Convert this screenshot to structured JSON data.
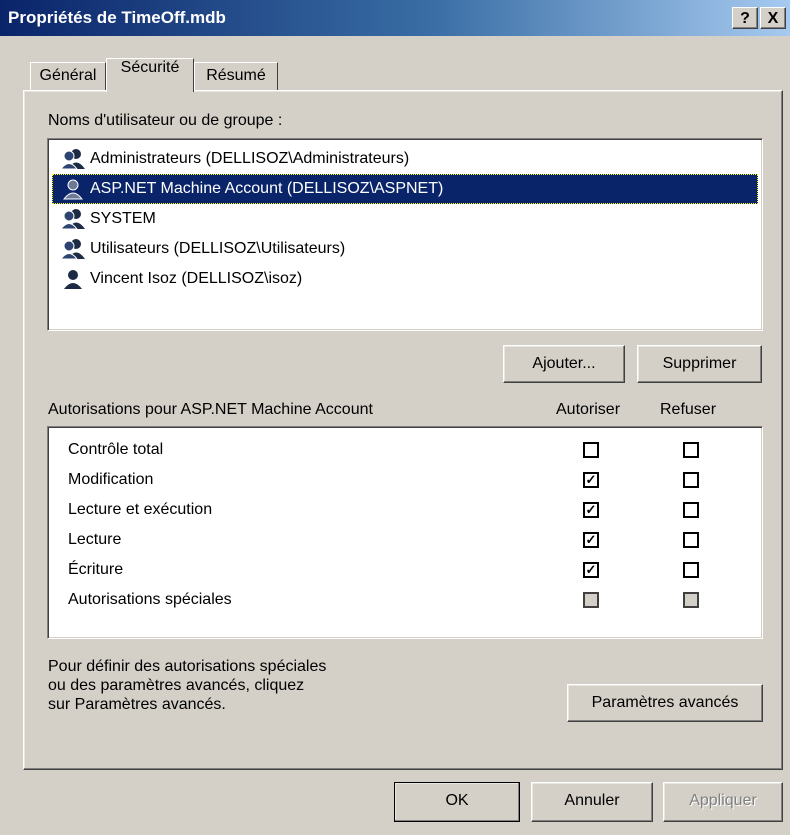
{
  "window": {
    "title": "Propriétés de TimeOff.mdb",
    "help_button": "?",
    "close_button": "X"
  },
  "tabs": [
    {
      "label": "Général",
      "active": false
    },
    {
      "label": "Sécurité",
      "active": true
    },
    {
      "label": "Résumé",
      "active": false
    }
  ],
  "users": {
    "label": "Noms d'utilisateur ou de groupe :",
    "items": [
      {
        "name": "Administrateurs (DELLISOZ\\Administrateurs)",
        "icon": "group-icon",
        "selected": false
      },
      {
        "name": "ASP.NET Machine Account (DELLISOZ\\ASPNET)",
        "icon": "user-icon",
        "selected": true
      },
      {
        "name": "SYSTEM",
        "icon": "group-icon",
        "selected": false
      },
      {
        "name": "Utilisateurs (DELLISOZ\\Utilisateurs)",
        "icon": "group-icon",
        "selected": false
      },
      {
        "name": "Vincent Isoz (DELLISOZ\\isoz)",
        "icon": "user-icon",
        "selected": false
      }
    ],
    "add_button": "Ajouter...",
    "remove_button": "Supprimer"
  },
  "permissions": {
    "label": "Autorisations pour ASP.NET Machine Account",
    "allow_header": "Autoriser",
    "deny_header": "Refuser",
    "rows": [
      {
        "name": "Contrôle total",
        "allow": false,
        "deny": false,
        "disabled": false
      },
      {
        "name": "Modification",
        "allow": true,
        "deny": false,
        "disabled": false
      },
      {
        "name": "Lecture et exécution",
        "allow": true,
        "deny": false,
        "disabled": false
      },
      {
        "name": "Lecture",
        "allow": true,
        "deny": false,
        "disabled": false
      },
      {
        "name": "Écriture",
        "allow": true,
        "deny": false,
        "disabled": false
      },
      {
        "name": "Autorisations spéciales",
        "allow": false,
        "deny": false,
        "disabled": true
      }
    ]
  },
  "advanced": {
    "text_line1": "Pour définir des autorisations spéciales",
    "text_line2": "ou des paramètres avancés, cliquez",
    "text_line3": "sur Paramètres avancés.",
    "button": "Paramètres avancés"
  },
  "footer": {
    "ok": "OK",
    "cancel": "Annuler",
    "apply": "Appliquer"
  }
}
